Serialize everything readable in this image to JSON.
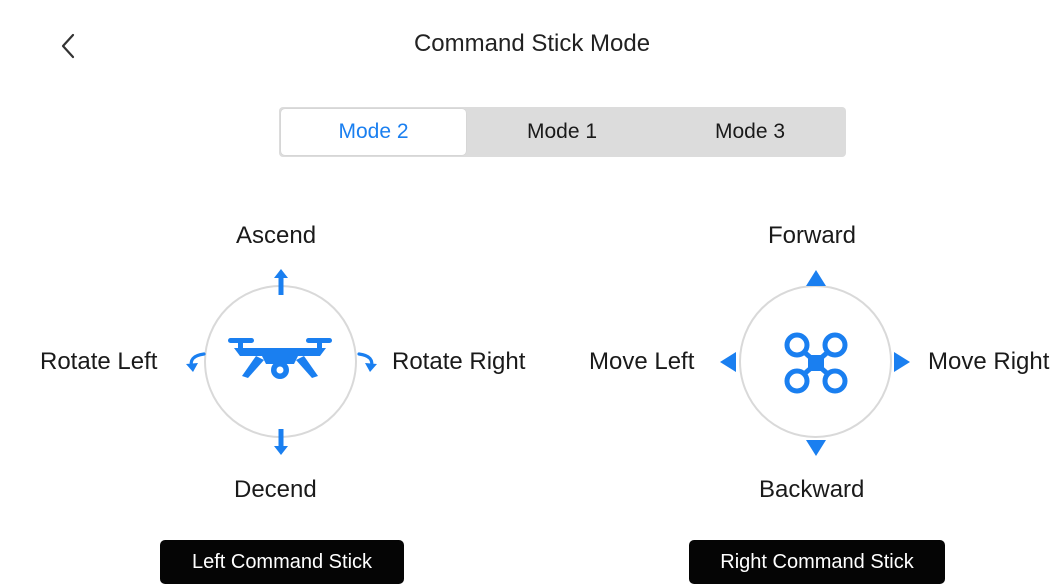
{
  "header": {
    "title": "Command Stick Mode",
    "back_icon": "chevron-left-icon"
  },
  "modes": {
    "selected": "Mode 2",
    "items": [
      "Mode 2",
      "Mode 1",
      "Mode 3"
    ]
  },
  "left_stick": {
    "up_label": "Ascend",
    "down_label": "Decend",
    "left_label": "Rotate Left",
    "right_label": "Rotate Right",
    "caption": "Left Command Stick",
    "center_icon": "drone-side-view-icon"
  },
  "right_stick": {
    "up_label": "Forward",
    "down_label": "Backward",
    "left_label": "Move Left",
    "right_label": "Move Right",
    "caption": "Right Command Stick",
    "center_icon": "drone-top-view-icon"
  },
  "colors": {
    "accent": "#1a7ff0",
    "ring": "#d9d9d9",
    "segment_bg": "#dcdcdc",
    "pill_bg": "#050505"
  }
}
